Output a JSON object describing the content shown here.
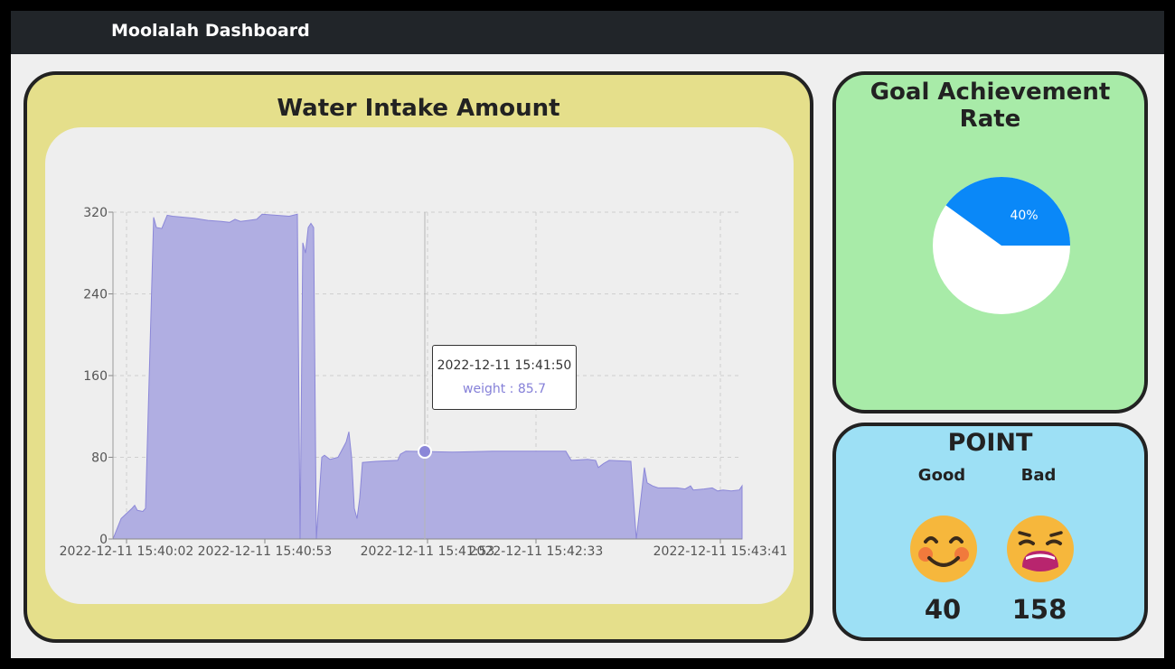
{
  "app": {
    "title": "Moolalah Dashboard"
  },
  "water": {
    "title": "Water Intake Amount",
    "tooltip": {
      "date": "2022-12-11 15:41:50",
      "label": "weight : 85.7"
    }
  },
  "goal": {
    "title": "Goal Achievement Rate",
    "percent_label": "40%",
    "percent": 40
  },
  "point": {
    "title": "POINT",
    "good_label": "Good",
    "bad_label": "Bad",
    "good_value": "40",
    "bad_value": "158",
    "good_icon": "smiling-face-icon",
    "bad_icon": "distressed-face-icon"
  },
  "colors": {
    "area": "#b0aee2",
    "area_line": "#8b87d8",
    "pie_fill": "#0a88f8",
    "pie_bg": "#ffffff"
  },
  "chart_data": {
    "type": "area",
    "title": "",
    "xlabel": "",
    "ylabel": "",
    "ylim": [
      0,
      320
    ],
    "yticks": [
      0,
      80,
      160,
      240,
      320
    ],
    "xtick_labels": [
      "2022-12-11 15:40:02",
      "2022-12-11 15:40:53",
      "2022-12-11 15:41:53",
      "2022-12-11 15:42:33",
      "2022-12-11 15:43:41"
    ],
    "x_range_seconds": [
      0,
      227
    ],
    "xtick_seconds": [
      0,
      51,
      111,
      151,
      219
    ],
    "grid": true,
    "series": [
      {
        "points": [
          [
            -5,
            0
          ],
          [
            -2,
            20
          ],
          [
            0,
            25
          ],
          [
            2,
            30
          ],
          [
            3,
            33
          ],
          [
            4,
            28
          ],
          [
            6,
            27
          ],
          [
            7,
            30
          ],
          [
            10,
            315
          ],
          [
            11,
            305
          ],
          [
            13,
            304
          ],
          [
            15,
            317
          ],
          [
            17,
            316
          ],
          [
            25,
            314
          ],
          [
            30,
            312
          ],
          [
            35,
            311
          ],
          [
            38,
            310
          ],
          [
            40,
            313
          ],
          [
            42,
            311
          ],
          [
            45,
            312
          ],
          [
            48,
            313
          ],
          [
            50,
            318
          ],
          [
            55,
            317
          ],
          [
            60,
            316
          ],
          [
            63,
            318
          ],
          [
            64,
            0
          ],
          [
            65,
            290
          ],
          [
            66,
            280
          ],
          [
            67,
            305
          ],
          [
            68,
            309
          ],
          [
            69,
            305
          ],
          [
            70,
            0
          ],
          [
            72,
            80
          ],
          [
            73,
            82
          ],
          [
            75,
            78
          ],
          [
            78,
            80
          ],
          [
            81,
            95
          ],
          [
            82,
            105
          ],
          [
            83,
            80
          ],
          [
            84,
            30
          ],
          [
            85,
            20
          ],
          [
            86,
            40
          ],
          [
            87,
            75
          ],
          [
            92,
            76
          ],
          [
            100,
            77
          ],
          [
            101,
            83
          ],
          [
            103,
            86
          ],
          [
            110,
            85.7
          ],
          [
            120,
            85
          ],
          [
            135,
            86
          ],
          [
            150,
            86
          ],
          [
            162,
            86
          ],
          [
            164,
            77
          ],
          [
            170,
            78
          ],
          [
            173,
            77
          ],
          [
            174,
            70
          ],
          [
            176,
            74
          ],
          [
            178,
            77
          ],
          [
            186,
            76
          ],
          [
            188,
            0
          ],
          [
            191,
            70
          ],
          [
            192,
            55
          ],
          [
            194,
            52
          ],
          [
            196,
            50
          ],
          [
            203,
            50
          ],
          [
            206,
            49
          ],
          [
            208,
            52
          ],
          [
            209,
            48
          ],
          [
            213,
            49
          ],
          [
            216,
            50
          ],
          [
            218,
            47
          ],
          [
            220,
            48
          ],
          [
            223,
            47
          ],
          [
            226,
            48
          ],
          [
            227,
            52
          ]
        ]
      }
    ],
    "highlight": {
      "x": 110,
      "y": 85.7
    }
  }
}
